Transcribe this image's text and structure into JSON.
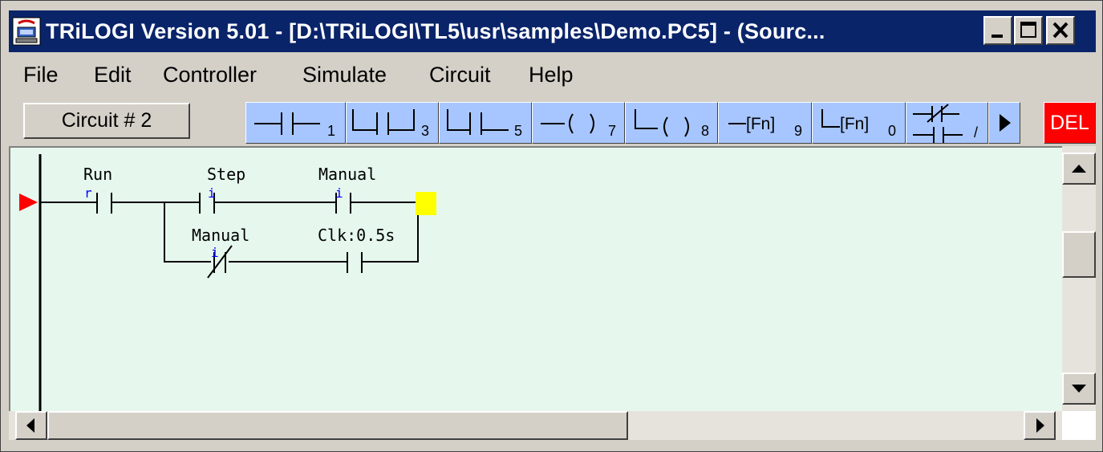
{
  "window": {
    "title": "TRiLOGI Version 5.01 - [D:\\TRiLOGI\\TL5\\usr\\samples\\Demo.PC5] - (Sourc...",
    "icons": {
      "app": "trilogi-app-icon",
      "minimize": "minimize-icon",
      "maximize": "maximize-icon",
      "close": "close-icon"
    }
  },
  "menu": {
    "items": [
      {
        "label": "File"
      },
      {
        "label": "Edit"
      },
      {
        "label": "Controller"
      },
      {
        "label": "Simulate"
      },
      {
        "label": "Circuit"
      },
      {
        "label": "Help"
      }
    ]
  },
  "toolbar": {
    "circuit_label": "Circuit # 2",
    "buttons": [
      {
        "icon": "contact-series-icon",
        "hotkey": "1"
      },
      {
        "icon": "contact-parallel-icon",
        "hotkey": "3"
      },
      {
        "icon": "contact-branch-icon",
        "hotkey": "5"
      },
      {
        "icon": "coil-icon",
        "hotkey": "7"
      },
      {
        "icon": "parallel-coil-icon",
        "hotkey": "8"
      },
      {
        "icon": "function-icon",
        "text": "[Fn]",
        "hotkey": "9"
      },
      {
        "icon": "parallel-function-icon",
        "text": "[Fn]",
        "hotkey": "0"
      },
      {
        "icon": "toggle-contact-icon",
        "hotkey": "/"
      },
      {
        "icon": "more-arrow-icon"
      },
      {
        "label": "DEL"
      }
    ]
  },
  "ladder": {
    "background": "#e6f8ee",
    "contacts": [
      {
        "label": "Run",
        "type": "r",
        "normally_closed": false
      },
      {
        "label": "Step",
        "type": "i",
        "normally_closed": false
      },
      {
        "label": "Manual",
        "type": "i",
        "normally_closed": false
      },
      {
        "label": "Manual",
        "type": "i",
        "normally_closed": true
      },
      {
        "label": "Clk:0.5s",
        "type": "",
        "normally_closed": false
      }
    ],
    "cursor_color": "#ffff00",
    "marker_color": "#ff0000"
  },
  "scroll_icons": {
    "up": "arrow-up-icon",
    "down": "arrow-down-icon",
    "left": "arrow-left-icon",
    "right": "arrow-right-icon"
  }
}
